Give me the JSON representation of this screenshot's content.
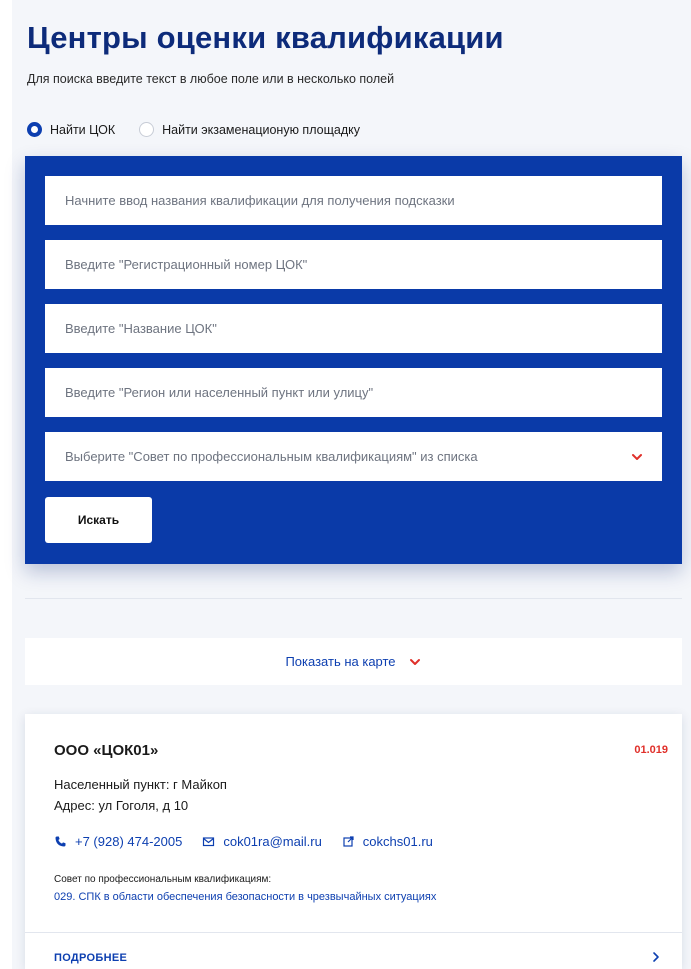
{
  "header": {
    "title": "Центры оценки квалификации",
    "subtitle": "Для поиска введите текст в любое поле или в несколько полей"
  },
  "search_mode": {
    "options": [
      {
        "label": "Найти ЦОК",
        "selected": true
      },
      {
        "label": "Найти экзаменационую площадку",
        "selected": false
      }
    ]
  },
  "search_form": {
    "qualification_placeholder": "Начните ввод названия квалификации для получения подсказки",
    "reg_number_placeholder": "Введите \"Регистрационный номер ЦОК\"",
    "name_placeholder": "Введите \"Название ЦОК\"",
    "region_placeholder": "Введите \"Регион или населенный пункт или улицу\"",
    "council_select": "Выберите \"Совет по профессиональным квалификациям\" из списка",
    "search_label": "Искать"
  },
  "map_toggle": {
    "label": "Показать на карте"
  },
  "result": {
    "name": "ООО «ЦОК01»",
    "code": "01.019",
    "locality": "Населенный пункт: г Майкоп",
    "address": "Адрес: ул Гоголя, д 10",
    "phone": "+7 (928) 474-2005",
    "email": "cok01ra@mail.ru",
    "website": "cokchs01.ru",
    "council_label": "Совет по профессиональным квалификациям:",
    "council_value": "029. СПК в области обеспечения безопасности в чрезвычайных ситуациях",
    "details_label": "ПОДРОБНЕЕ"
  },
  "colors": {
    "primary": "#0a3aa8",
    "title": "#0d2b7a",
    "accent_red": "#e0302a",
    "background": "#f4f6fa"
  },
  "icons": {
    "radio_selected": "radio-checked-icon",
    "radio_unselected": "radio-unchecked-icon",
    "select_chevron": "chevron-down-icon",
    "phone": "phone-icon",
    "email": "mail-icon",
    "website": "external-link-icon",
    "details": "chevron-right-icon"
  }
}
